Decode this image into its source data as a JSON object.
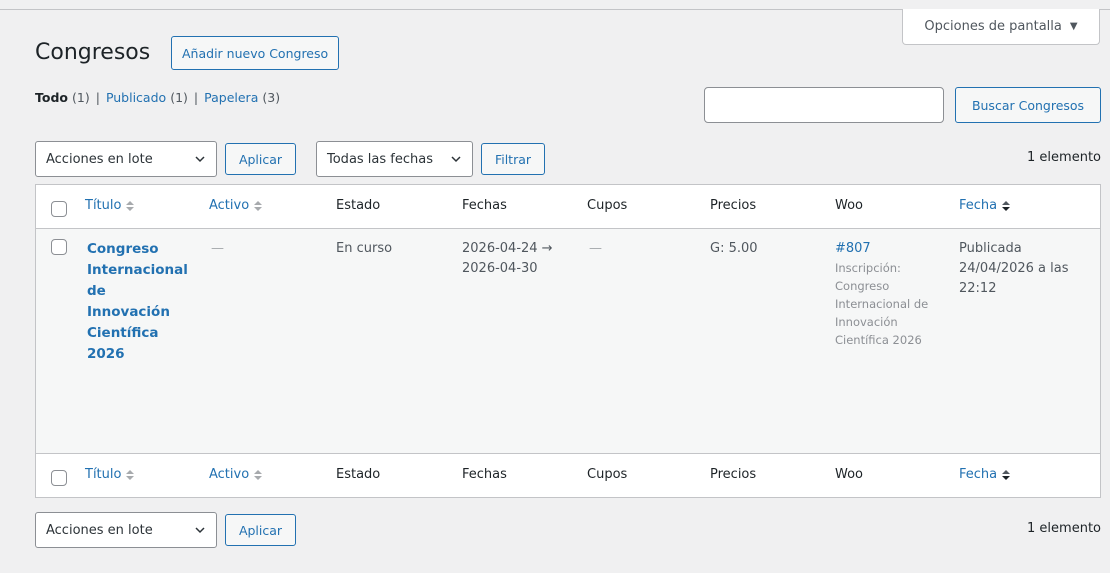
{
  "screen_options": {
    "label": "Opciones de pantalla",
    "icon": "triangle-down-icon"
  },
  "header": {
    "title": "Congresos",
    "add_new": "Añadir nuevo Congreso"
  },
  "views": {
    "all_label": "Todo",
    "all_count": "(1)",
    "published_label": "Publicado",
    "published_count": "(1)",
    "trash_label": "Papelera",
    "trash_count": "(3)",
    "separator": "|"
  },
  "search": {
    "value": "",
    "button": "Buscar Congresos"
  },
  "tablenav_top": {
    "bulk_action": "Acciones en lote",
    "apply": "Aplicar",
    "date_filter": "Todas las fechas",
    "filter": "Filtrar",
    "count": "1 elemento"
  },
  "tablenav_bottom": {
    "bulk_action": "Acciones en lote",
    "apply": "Aplicar",
    "count": "1 elemento"
  },
  "columns": {
    "title": "Título",
    "active": "Activo",
    "status": "Estado",
    "dates": "Fechas",
    "seats": "Cupos",
    "prices": "Precios",
    "woo": "Woo",
    "date": "Fecha"
  },
  "row": {
    "title_lines": [
      "Congreso",
      "Internacional",
      "de",
      "Innovación",
      "Científica",
      "2026"
    ],
    "active": "—",
    "status": "En curso",
    "dates_line1": "2026-04-24 →",
    "dates_line2": "2026-04-30",
    "seats": "—",
    "prices": "G: 5.00",
    "woo_link": "#807",
    "woo_lines": [
      "Inscripción:",
      "Congreso",
      "Internacional de",
      "Innovación",
      "Científica 2026"
    ],
    "date_status": "Publicada",
    "date_line1": "24/04/2026 a las",
    "date_line2": "22:12"
  },
  "colors": {
    "link": "#2271b1",
    "background": "#f0f0f1",
    "border": "#c3c4c7"
  }
}
